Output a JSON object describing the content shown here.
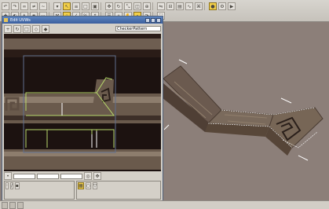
{
  "toolbar": {
    "row1": [
      "undo-icon",
      "redo-icon",
      "link-icon",
      "unlink-icon",
      "bind-icon",
      "select-filter-icon",
      "select-icon",
      "select-name-icon",
      "rect-region-icon",
      "window-crossing-icon",
      "move-icon",
      "rotate-icon",
      "scale-icon",
      "ref-coord-icon",
      "pivot-icon",
      "mirror-icon",
      "align-icon",
      "layer-icon",
      "curve-editor-icon",
      "schematic-icon",
      "material-editor-icon",
      "render-setup-icon",
      "render-icon"
    ],
    "row2": [
      "create-icon",
      "modify-icon",
      "hierarchy-icon",
      "motion-icon",
      "display-icon",
      "utilities-icon",
      "snap-icon",
      "angle-snap-icon",
      "percent-snap-icon",
      "spinner-snap-icon",
      "named-sel-icon",
      "lock-icon",
      "pan-icon",
      "zoom-icon",
      "orbit-icon",
      "maximize-icon"
    ]
  },
  "editor": {
    "title": "Edit UVWs",
    "dropdown": "CheckerPattern"
  },
  "status": {
    "tabs": [
      "",
      "",
      ""
    ]
  },
  "colors": {
    "viewport_bg": "#8c7f79",
    "texture_dark": "#1c1210",
    "uv_green": "#b7d86b",
    "highlight_yellow": "#f2cf4a"
  }
}
